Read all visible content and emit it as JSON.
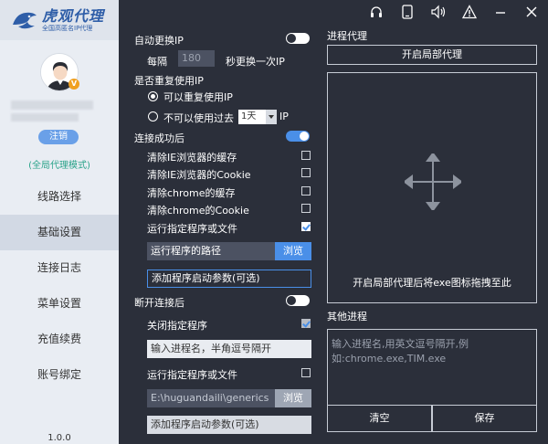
{
  "sidebar": {
    "logo_title": "虎观代理",
    "logo_sub": "全国高匿名IP代理",
    "vip_badge": "V",
    "logout": "注销",
    "mode": "(全局代理模式)",
    "nav": [
      "线路选择",
      "基础设置",
      "连接日志",
      "菜单设置",
      "充值续费",
      "账号绑定"
    ],
    "active_index": 1,
    "version": "1.0.0"
  },
  "toolbar_icons": [
    "headset-icon",
    "tablet-icon",
    "speaker-icon",
    "warning-icon",
    "minimize-icon",
    "close-icon"
  ],
  "settings": {
    "auto_change_ip": {
      "label": "自动更换IP",
      "on": false
    },
    "interval": {
      "prefix": "每隔",
      "value": "180",
      "suffix": "秒更换一次IP"
    },
    "reuse": {
      "label": "是否重复使用IP",
      "opt_yes": "可以重复使用IP",
      "opt_no": "不可以使用过去",
      "days": "1天",
      "unit": "IP"
    },
    "after_connect": {
      "label": "连接成功后",
      "on": true,
      "items": [
        {
          "label": "清除IE浏览器的缓存",
          "checked": false
        },
        {
          "label": "清除IE浏览器的Cookie",
          "checked": false
        },
        {
          "label": "清除chrome的缓存",
          "checked": false
        },
        {
          "label": "清除chrome的Cookie",
          "checked": false
        },
        {
          "label": "运行指定程序或文件",
          "checked": true
        }
      ],
      "path_placeholder": "运行程序的路径",
      "browse": "浏览",
      "args_placeholder": "添加程序启动参数(可选)"
    },
    "after_disconnect": {
      "label": "断开连接后",
      "on": false,
      "close_program": {
        "label": "关闭指定程序",
        "checked": true
      },
      "process_placeholder": "输入进程名，半角逗号隔开",
      "run_program": {
        "label": "运行指定程序或文件",
        "checked": false
      },
      "path_value": "E:\\huguandaili\\generics",
      "browse": "浏览",
      "args_placeholder": "添加程序启动参数(可选)"
    }
  },
  "process_proxy": {
    "title": "进程代理",
    "open_button": "开启局部代理",
    "drop_hint": "开启局部代理后将exe图标拖拽至此",
    "other_title": "其他进程",
    "other_placeholder_line1": "输入进程名,用英文逗号隔开,例",
    "other_placeholder_line2": "如:chrome.exe,TIM.exe",
    "clear": "清空",
    "save": "保存"
  }
}
